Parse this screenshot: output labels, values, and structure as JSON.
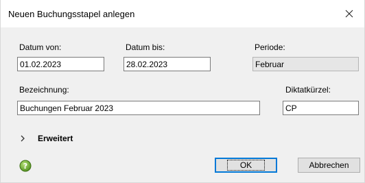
{
  "window": {
    "title": "Neuen Buchungsstapel anlegen",
    "close_label": "×"
  },
  "form": {
    "date_from": {
      "label": "Datum von:",
      "value": "01.02.2023"
    },
    "date_to": {
      "label": "Datum bis:",
      "value": "28.02.2023"
    },
    "period": {
      "label": "Periode:",
      "value": "Februar"
    },
    "description": {
      "label": "Bezeichnung:",
      "value": "Buchungen Februar 2023"
    },
    "dictation": {
      "label": "Diktatkürzel:",
      "value": "CP"
    }
  },
  "advanced": {
    "label": "Erweitert",
    "icon": "chevron-right-icon"
  },
  "footer": {
    "help_icon": "help-icon",
    "ok_label": "OK",
    "cancel_label": "Abbrechen"
  },
  "colors": {
    "dialog_bg": "#f0f0f0",
    "title_bg": "#ffffff",
    "default_button_border": "#0078d7",
    "help_icon_green": "#6aaa2a"
  }
}
